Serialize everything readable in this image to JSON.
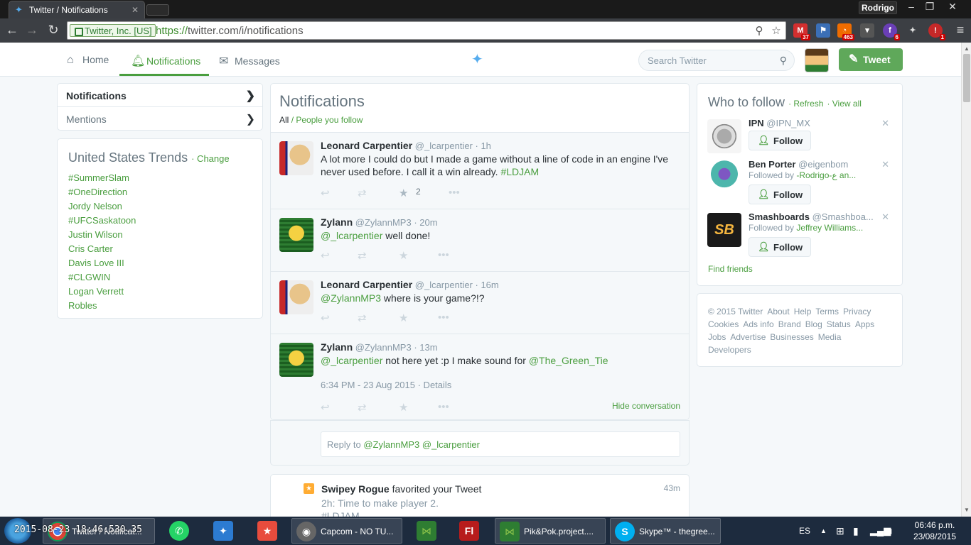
{
  "browser": {
    "tab_title": "Twitter / Notifications",
    "user_badge": "Rodrigo",
    "secure_label": "Twitter, Inc. [US]",
    "url_scheme": "https://",
    "url_rest": "twitter.com/i/notifications",
    "extensions": [
      {
        "name": "gmail-extension",
        "badge": "37"
      },
      {
        "name": "bookmark-extension",
        "badge": ""
      },
      {
        "name": "rss-extension",
        "badge": "463"
      },
      {
        "name": "pocket-extension",
        "badge": ""
      },
      {
        "name": "purple-extension",
        "badge": "6"
      },
      {
        "name": "twitter-extension",
        "badge": ""
      },
      {
        "name": "adblock-extension",
        "badge": "1"
      }
    ]
  },
  "nav": {
    "home": "Home",
    "notifications": "Notifications",
    "messages": "Messages",
    "search_placeholder": "Search Twitter",
    "tweet_button": "Tweet"
  },
  "left_nav": {
    "items": [
      "Notifications",
      "Mentions"
    ]
  },
  "trends": {
    "title": "United States Trends",
    "change": "· Change",
    "items": [
      "#SummerSlam",
      "#OneDirection",
      "Jordy Nelson",
      "#UFCSaskatoon",
      "Justin Wilson",
      "Cris Carter",
      "Davis Love III",
      "#CLGWIN",
      "Logan Verrett",
      "Robles"
    ]
  },
  "feed": {
    "title": "Notifications",
    "filter_all": "All",
    "filter_follow": "/ People you follow",
    "tweets": [
      {
        "name": "Leonard Carpentier",
        "handle": "@_lcarpentier",
        "time": "· 1h",
        "text": "A lot more I could do but I made a game without a line of code in an engine I've never used before. I call it a win already.",
        "hashtag": "#LDJAM",
        "fav_count": "2"
      },
      {
        "name": "Zylann",
        "handle": "@ZylannMP3",
        "time": "· 20m",
        "mention": "@_lcarpentier",
        "text": " well done!"
      },
      {
        "name": "Leonard Carpentier",
        "handle": "@_lcarpentier",
        "time": "· 16m",
        "mention": "@ZylannMP3",
        "text": " where is your game?!?"
      },
      {
        "name": "Zylann",
        "handle": "@ZylannMP3",
        "time": "· 13m",
        "mention": "@_lcarpentier",
        "text": " not here yet :p I make sound for ",
        "mention2": "@The_Green_Tie",
        "detail_time": "6:34 PM - 23 Aug 2015",
        "detail_link": "· Details",
        "hide": "Hide conversation"
      }
    ],
    "reply": {
      "prefix": "Reply to ",
      "mentions": "@ZylannMP3 @_lcarpentier"
    },
    "favorite": {
      "name": "Swipey Rogue",
      "action": " favorited your Tweet",
      "time": "43m",
      "text": "2h: Time to make player 2.",
      "hashtag": "#LDJAM"
    }
  },
  "who_to_follow": {
    "title": "Who to follow",
    "refresh": "· Refresh",
    "view_all": "· View all",
    "follow_label": "Follow",
    "suggestions": [
      {
        "name": "IPN",
        "handle": "@IPN_MX",
        "sub_prefix": "",
        "sub_names": ""
      },
      {
        "name": "Ben Porter",
        "handle": "@eigenbom",
        "sub_prefix": "Followed by ",
        "sub_names": "-Rodrigo-ع an..."
      },
      {
        "name": "Smashboards",
        "handle": "@Smashboa...",
        "sub_prefix": "Followed by ",
        "sub_names": "Jeffrey Williams..."
      }
    ],
    "find_friends": "Find friends"
  },
  "footer": {
    "links": [
      "© 2015 Twitter",
      "About",
      "Help",
      "Terms",
      "Privacy",
      "Cookies",
      "Ads info",
      "Brand",
      "Blog",
      "Status",
      "Apps",
      "Jobs",
      "Advertise",
      "Businesses",
      "Media",
      "Developers"
    ]
  },
  "taskbar": {
    "overlay_timestamp": "2015-08-23 18:46:530.35",
    "apps": [
      {
        "name": "chrome",
        "label": "Twitter / Notificat..."
      },
      {
        "name": "whatsapp",
        "label": ""
      },
      {
        "name": "twitter",
        "label": ""
      },
      {
        "name": "app-red",
        "label": ""
      },
      {
        "name": "media",
        "label": "Capcom - NO TU..."
      },
      {
        "name": "gamemaker",
        "label": ""
      },
      {
        "name": "flash",
        "label": ""
      },
      {
        "name": "gamemaker2",
        "label": "Pik&Pok.project...."
      },
      {
        "name": "skype",
        "label": "Skype™ - thegree..."
      }
    ],
    "lang": "ES",
    "time": "06:46 p.m.",
    "date": "23/08/2015"
  }
}
